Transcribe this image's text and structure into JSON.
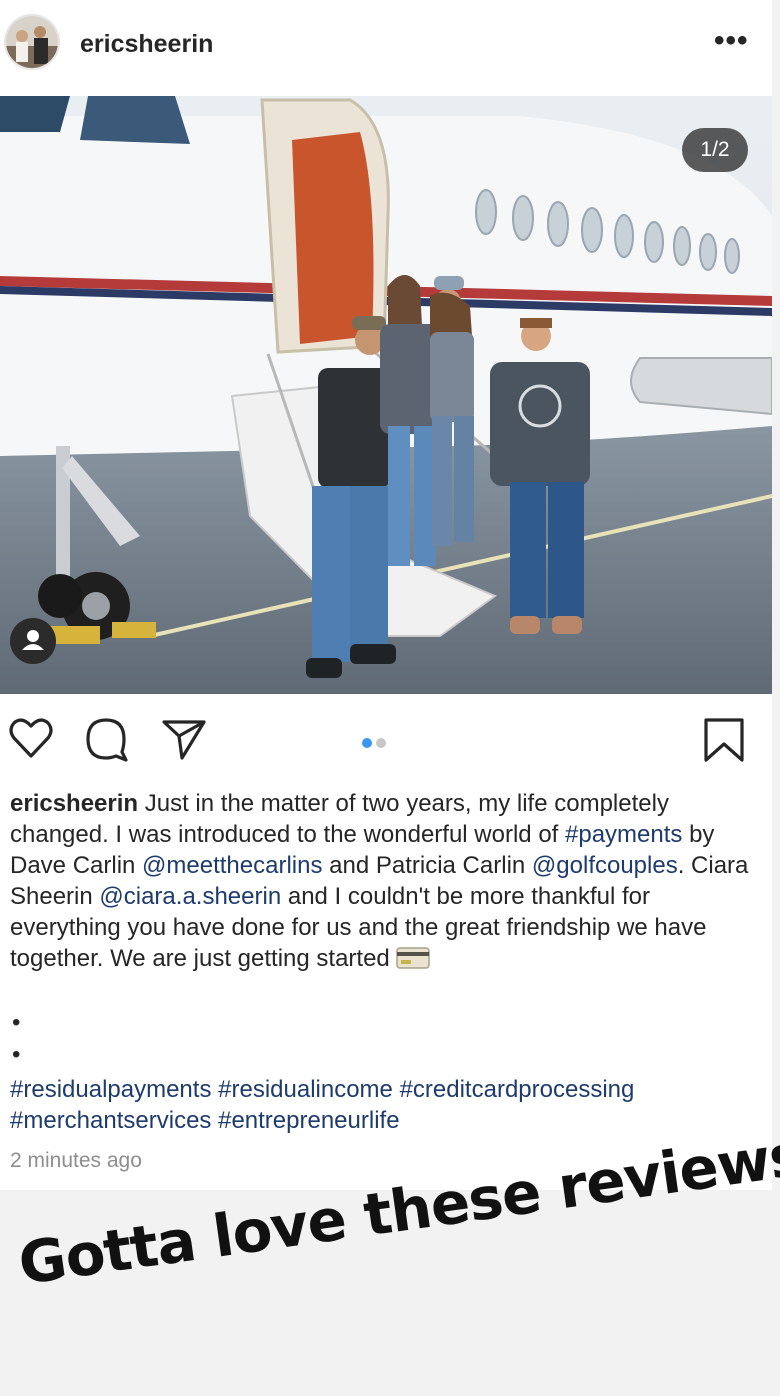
{
  "post": {
    "username": "ericsheerin",
    "more_label": "•••",
    "photo_counter": "1/2",
    "caption_parts": {
      "username": "ericsheerin",
      "t1": " Just in the matter of two years, my life completely changed. I was introduced to the wonderful world of ",
      "h1": "#payments",
      "t2": " by Dave Carlin ",
      "m1": "@meetthecarlins",
      "t3": " and Patricia Carlin ",
      "m2": "@golfcouples",
      "t4": ". Ciara Sheerin ",
      "m3": "@ciara.a.sheerin",
      "t5": " and I couldn't be more thankful for everything you have done for us and the great friendship we have together. We are just getting started"
    },
    "bullet1": "•",
    "bullet2": "•",
    "hashtags": [
      "#residualpayments",
      "#residualincome",
      "#creditcardprocessing",
      "#merchantservices",
      "#entrepreneurlife"
    ],
    "timestamp": "2 minutes ago"
  },
  "overlay": {
    "text": "Gotta love these reviews"
  },
  "icons": {
    "like": "heart-icon",
    "comment": "comment-icon",
    "share": "send-icon",
    "save": "bookmark-icon",
    "tag": "person-icon"
  },
  "colors": {
    "link": "#1e3b6e",
    "active_dot": "#3897f0",
    "inactive_dot": "#c7c7c7"
  }
}
